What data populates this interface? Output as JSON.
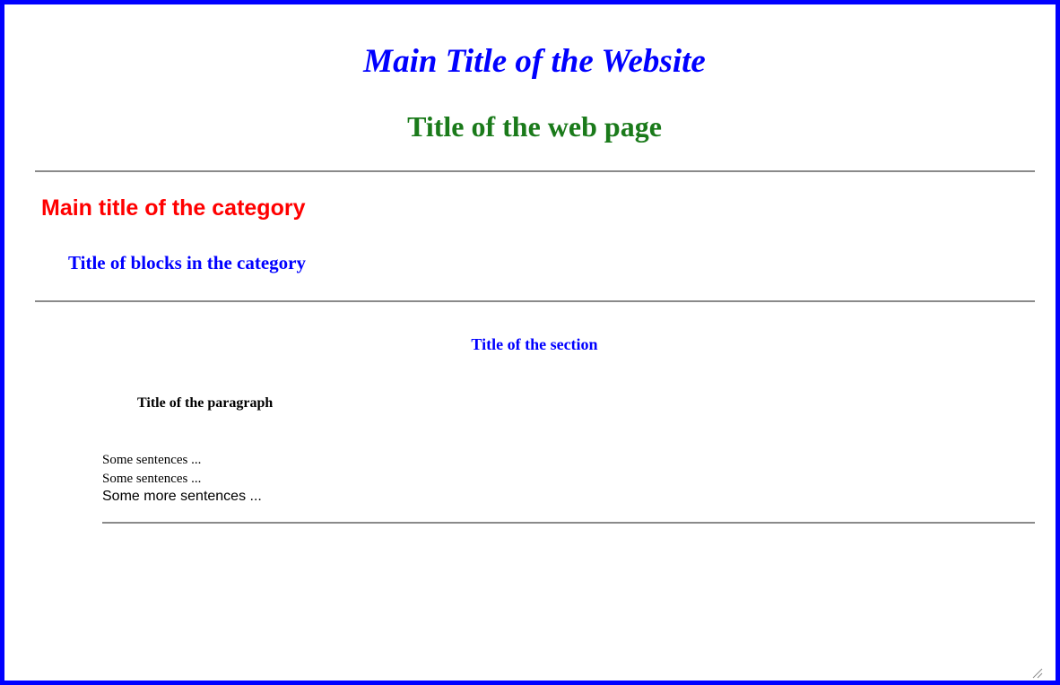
{
  "website": {
    "main_title": "Main Title of the Website",
    "page_title": "Title of the web page"
  },
  "category": {
    "main_title": "Main title of the category",
    "blocks_title": "Title of blocks in the category"
  },
  "section": {
    "title": "Title of the section",
    "paragraph_title": "Title of the paragraph",
    "sentences": [
      "Some sentences ...",
      "Some sentences ...",
      "Some more sentences ..."
    ]
  },
  "colors": {
    "frame_border": "#0000ff",
    "website_title": "#0000ff",
    "page_title": "#1a7a1a",
    "category_title": "#ff0000",
    "blocks_title": "#0000ff",
    "section_title": "#0000ff",
    "rule": "#8a8a8a"
  },
  "icons": {
    "resize_grip": "resize-grip-icon"
  }
}
